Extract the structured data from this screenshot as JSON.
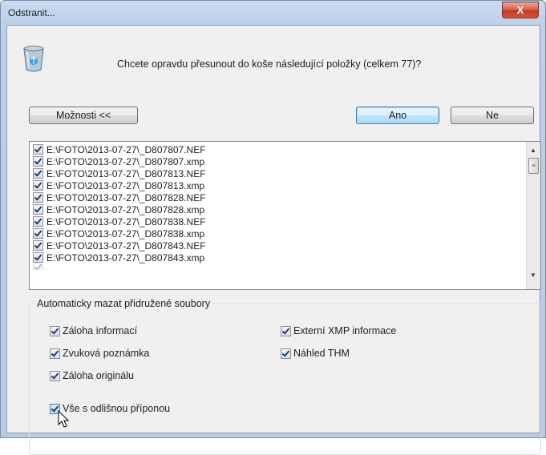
{
  "window": {
    "title": "Odstranit...",
    "close_label": "X",
    "prompt": "Chcete opravdu přesunout do koše následující položky (celkem 77)?",
    "accent_color": "#3c7fb1"
  },
  "buttons": {
    "options": "Možnosti <<",
    "yes": "Ano",
    "no": "Ne"
  },
  "files": [
    "E:\\FOTO\\2013-07-27\\_D807807.NEF",
    "E:\\FOTO\\2013-07-27\\_D807807.xmp",
    "E:\\FOTO\\2013-07-27\\_D807813.NEF",
    "E:\\FOTO\\2013-07-27\\_D807813.xmp",
    "E:\\FOTO\\2013-07-27\\_D807828.NEF",
    "E:\\FOTO\\2013-07-27\\_D807828.xmp",
    "E:\\FOTO\\2013-07-27\\_D807838.NEF",
    "E:\\FOTO\\2013-07-27\\_D807838.xmp",
    "E:\\FOTO\\2013-07-27\\_D807843.NEF",
    "E:\\FOTO\\2013-07-27\\_D807843.xmp"
  ],
  "auto_delete": {
    "label": "Automaticky mazat přidružené soubory",
    "backup_info": "Záloha informací",
    "voice_note": "Zvuková poznámka",
    "backup_original": "Záloha originálu",
    "external_xmp": "Externí XMP informace",
    "thm_preview": "Náhled THM",
    "other_extension": "Vše s odlišnou příponou"
  }
}
